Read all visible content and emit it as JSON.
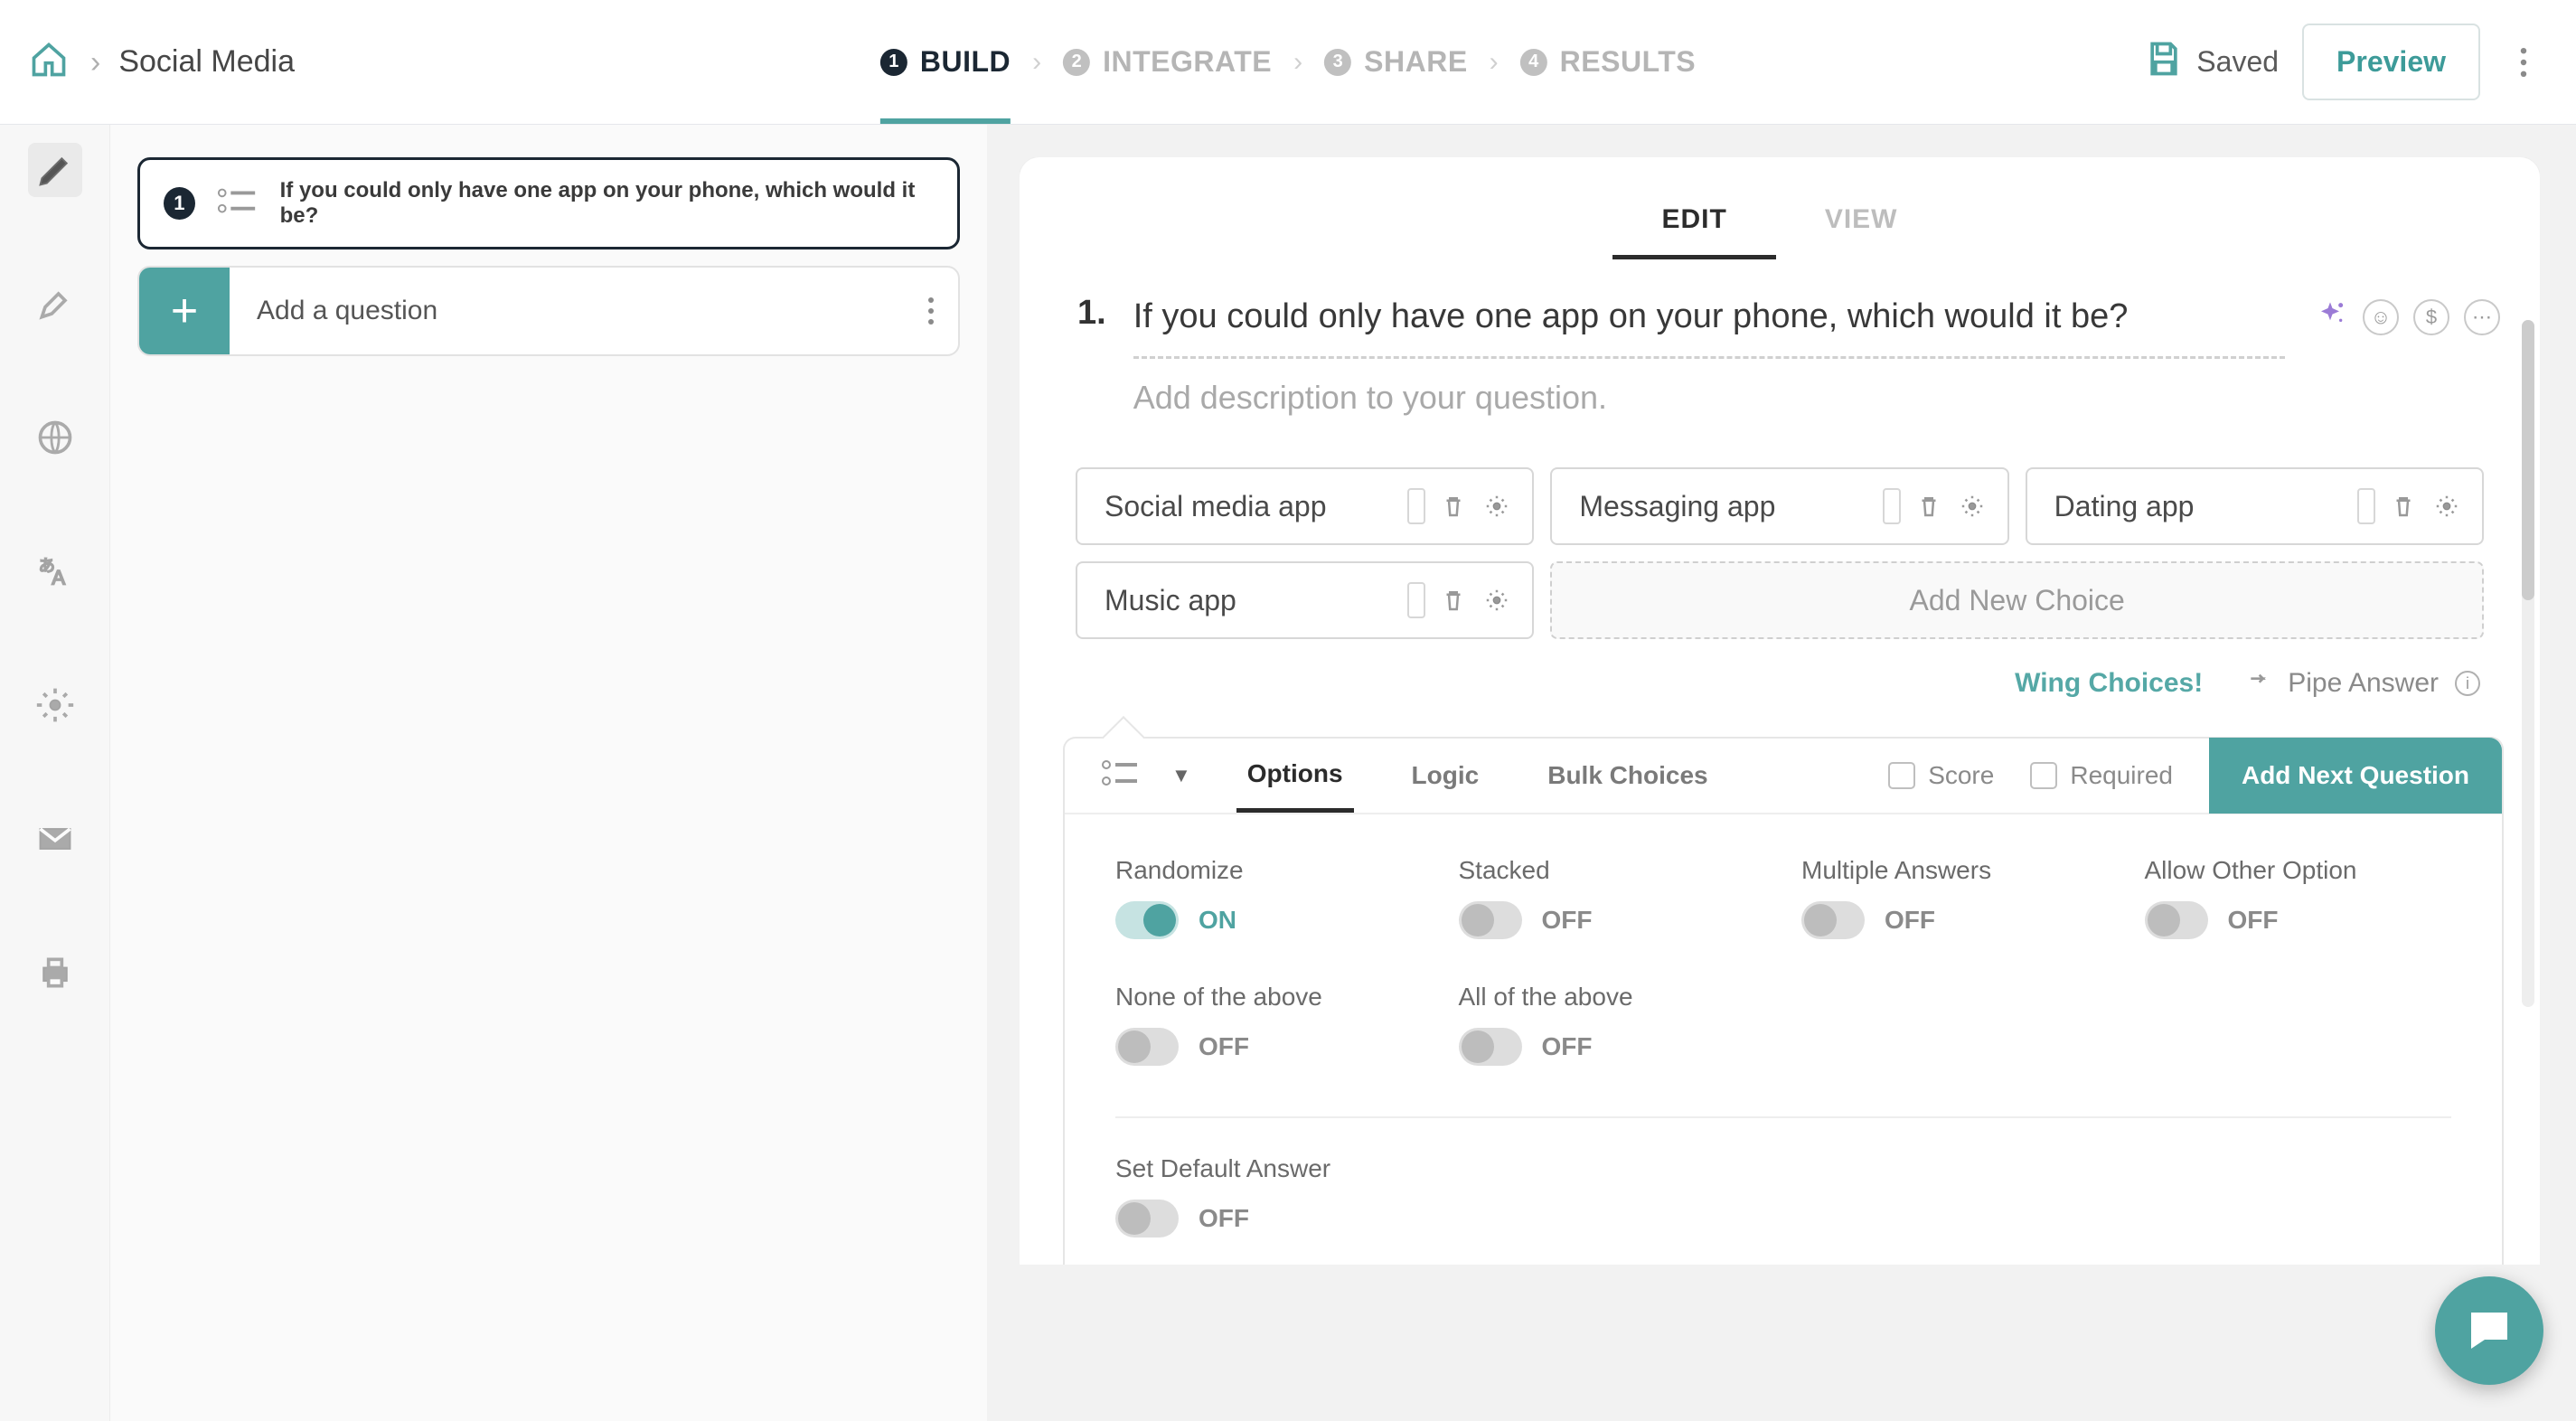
{
  "breadcrumb": {
    "title": "Social Media"
  },
  "wizard": [
    {
      "num": "1",
      "label": "BUILD",
      "active": true
    },
    {
      "num": "2",
      "label": "INTEGRATE",
      "active": false
    },
    {
      "num": "3",
      "label": "SHARE",
      "active": false
    },
    {
      "num": "4",
      "label": "RESULTS",
      "active": false
    }
  ],
  "header": {
    "saved": "Saved",
    "preview": "Preview"
  },
  "sidebar_icons": [
    "pen-icon",
    "brush-icon",
    "globe-icon",
    "translate-icon",
    "gear-icon",
    "mail-icon",
    "print-icon"
  ],
  "left": {
    "q1_num": "1",
    "q1_text": "If you could only have one app on your phone, which would it be?",
    "add_question": "Add a question"
  },
  "tabs_ev": {
    "edit": "EDIT",
    "view": "VIEW",
    "active": "edit"
  },
  "question": {
    "number": "1.",
    "title": "If you could only have one app on your phone, which would it be?",
    "desc_placeholder": "Add description to your question."
  },
  "choices": [
    "Social media app",
    "Messaging app",
    "Dating app",
    "Music app"
  ],
  "add_choice": "Add New Choice",
  "helpers": {
    "wing": "Wing Choices!",
    "pipe": "Pipe Answer"
  },
  "cfg": {
    "tabs": [
      "Options",
      "Logic",
      "Bulk Choices"
    ],
    "active_tab": "Options",
    "score": "Score",
    "required": "Required",
    "add_next": "Add Next Question"
  },
  "options": {
    "randomize": {
      "label": "Randomize",
      "on": true
    },
    "stacked": {
      "label": "Stacked",
      "on": false
    },
    "multiple": {
      "label": "Multiple Answers",
      "on": false
    },
    "allow_other": {
      "label": "Allow Other Option",
      "on": false
    },
    "none_above": {
      "label": "None of the above",
      "on": false
    },
    "all_above": {
      "label": "All of the above",
      "on": false
    }
  },
  "default_answer": {
    "label": "Set Default Answer",
    "on": false
  },
  "toggle_labels": {
    "on": "ON",
    "off": "OFF"
  },
  "colors": {
    "accent": "#4FA3A1"
  }
}
